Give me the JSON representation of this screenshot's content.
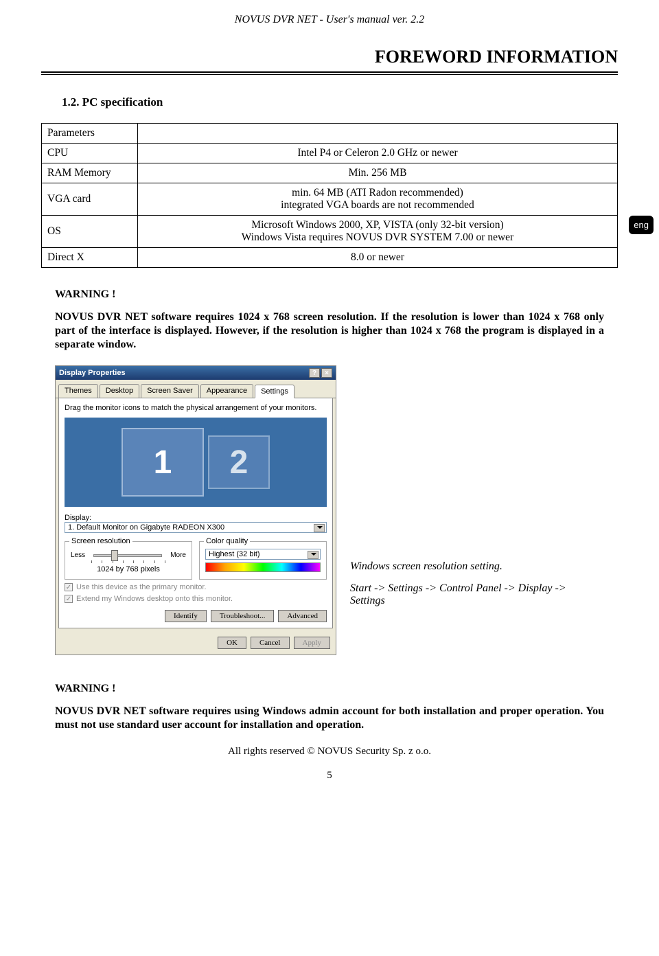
{
  "header": {
    "running_title": "NOVUS DVR NET  -  User's manual ver.  2.2"
  },
  "chapter": {
    "title": "FOREWORD INFORMATION"
  },
  "section": {
    "title": "1.2. PC specification"
  },
  "lang_badge": "eng",
  "spec_table": {
    "rows": [
      {
        "label": "Parameters",
        "value": ""
      },
      {
        "label": "CPU",
        "value": "Intel P4 or Celeron 2.0 GHz or newer"
      },
      {
        "label": "RAM Memory",
        "value": "Min. 256 MB"
      },
      {
        "label": "VGA card",
        "value": "min. 64 MB (ATI Radon recommended)\nintegrated VGA boards are not recommended"
      },
      {
        "label": "OS",
        "value": "Microsoft Windows 2000, XP, VISTA (only 32-bit version)\nWindows Vista requires NOVUS DVR SYSTEM 7.00 or newer"
      },
      {
        "label": "Direct X",
        "value": "8.0 or newer"
      }
    ]
  },
  "warning1": {
    "head": "WARNING !",
    "text": "NOVUS DVR NET software requires 1024 x 768 screen resolution. If the resolution is lower than 1024 x 768 only part of the interface is displayed. However, if the resolution is higher than 1024 x 768 the program is displayed in a separate window."
  },
  "dialog": {
    "title": "Display Properties",
    "tabs": [
      "Themes",
      "Desktop",
      "Screen Saver",
      "Appearance",
      "Settings"
    ],
    "active_tab": 4,
    "instruction": "Drag the monitor icons to match the physical arrangement of your monitors.",
    "monitors": [
      "1",
      "2"
    ],
    "display_label": "Display:",
    "display_value": "1. Default Monitor on Gigabyte RADEON X300",
    "screen_res": {
      "legend": "Screen resolution",
      "less": "Less",
      "more": "More",
      "value": "1024 by 768 pixels"
    },
    "color_quality": {
      "legend": "Color quality",
      "value": "Highest (32 bit)"
    },
    "checks": [
      "Use this device as the primary monitor.",
      "Extend my Windows desktop onto this monitor."
    ],
    "inner_buttons": [
      "Identify",
      "Troubleshoot...",
      "Advanced"
    ],
    "outer_buttons": [
      "OK",
      "Cancel",
      "Apply"
    ]
  },
  "caption": {
    "line1": "Windows screen resolution setting.",
    "line2": "Start -> Settings ->  Control  Panel  -> Display -> Settings"
  },
  "warning2": {
    "head": "WARNING !",
    "text": "NOVUS DVR NET software requires using Windows admin account for both installation and proper operation. You must not use standard user account for installation and operation."
  },
  "footer": {
    "copyright": "All rights reserved © NOVUS Security Sp. z o.o.",
    "page": "5"
  }
}
